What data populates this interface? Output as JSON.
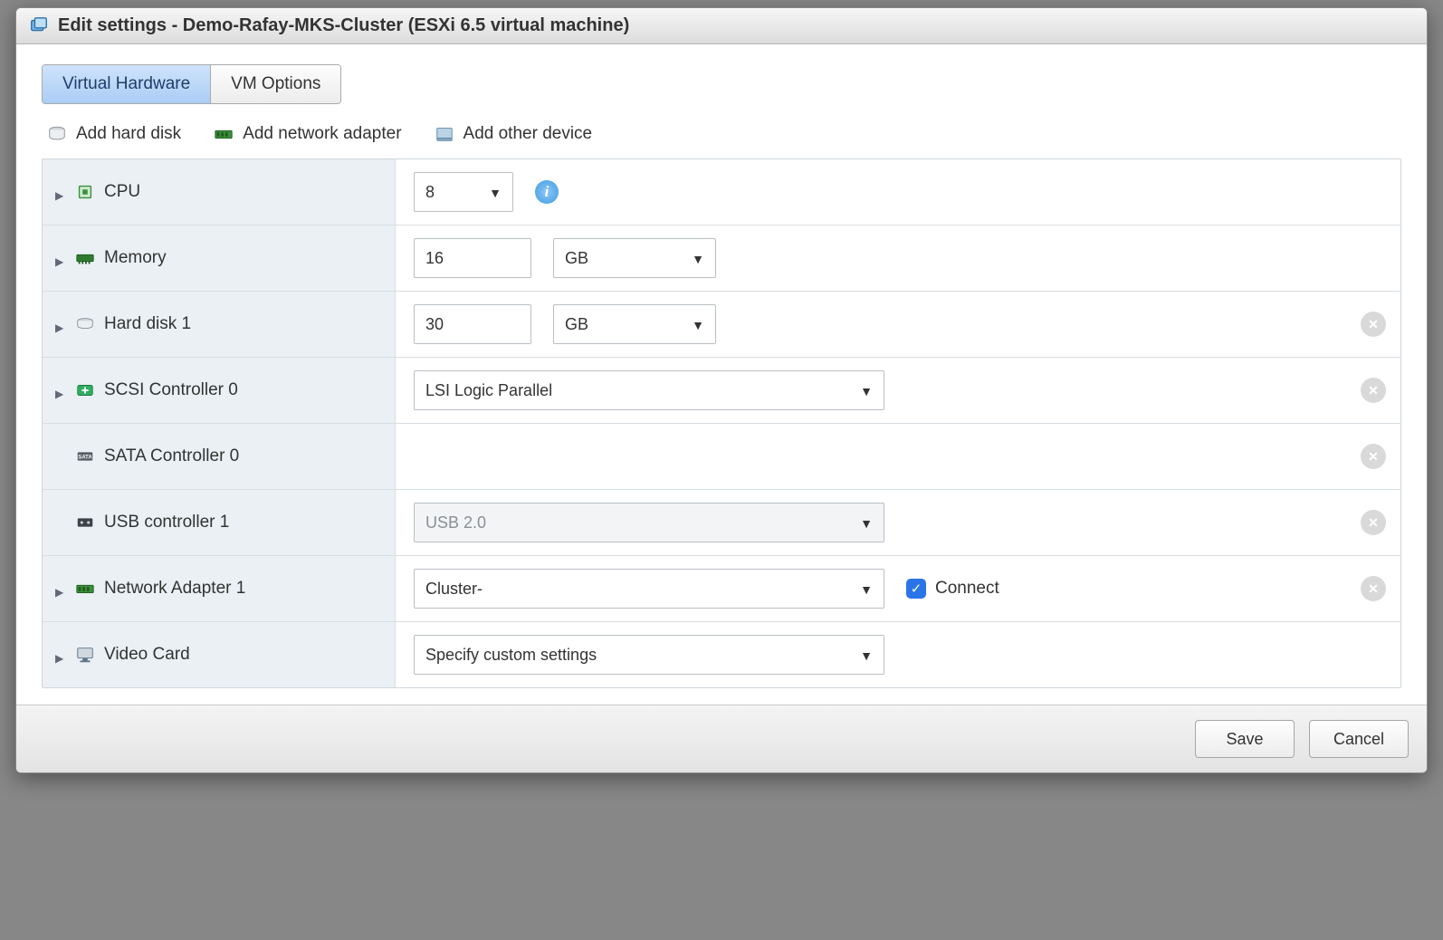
{
  "title": "Edit settings - Demo-Rafay-MKS-Cluster (ESXi 6.5 virtual machine)",
  "tabs": {
    "virtual_hardware": "Virtual Hardware",
    "vm_options": "VM Options"
  },
  "toolbar": {
    "add_hard_disk": "Add hard disk",
    "add_network_adapter": "Add network adapter",
    "add_other_device": "Add other device"
  },
  "rows": {
    "cpu": {
      "label": "CPU",
      "value": "8"
    },
    "memory": {
      "label": "Memory",
      "value": "16",
      "unit": "GB"
    },
    "hard_disk_1": {
      "label": "Hard disk 1",
      "value": "30",
      "unit": "GB"
    },
    "scsi_controller_0": {
      "label": "SCSI Controller 0",
      "value": "LSI Logic Parallel"
    },
    "sata_controller_0": {
      "label": "SATA Controller 0"
    },
    "usb_controller_1": {
      "label": "USB controller 1",
      "value": "USB 2.0"
    },
    "network_adapter_1": {
      "label": "Network Adapter 1",
      "value": "Cluster-",
      "connect_label": "Connect",
      "connect_checked": true
    },
    "video_card": {
      "label": "Video Card",
      "value": "Specify custom settings"
    }
  },
  "footer": {
    "save": "Save",
    "cancel": "Cancel"
  }
}
